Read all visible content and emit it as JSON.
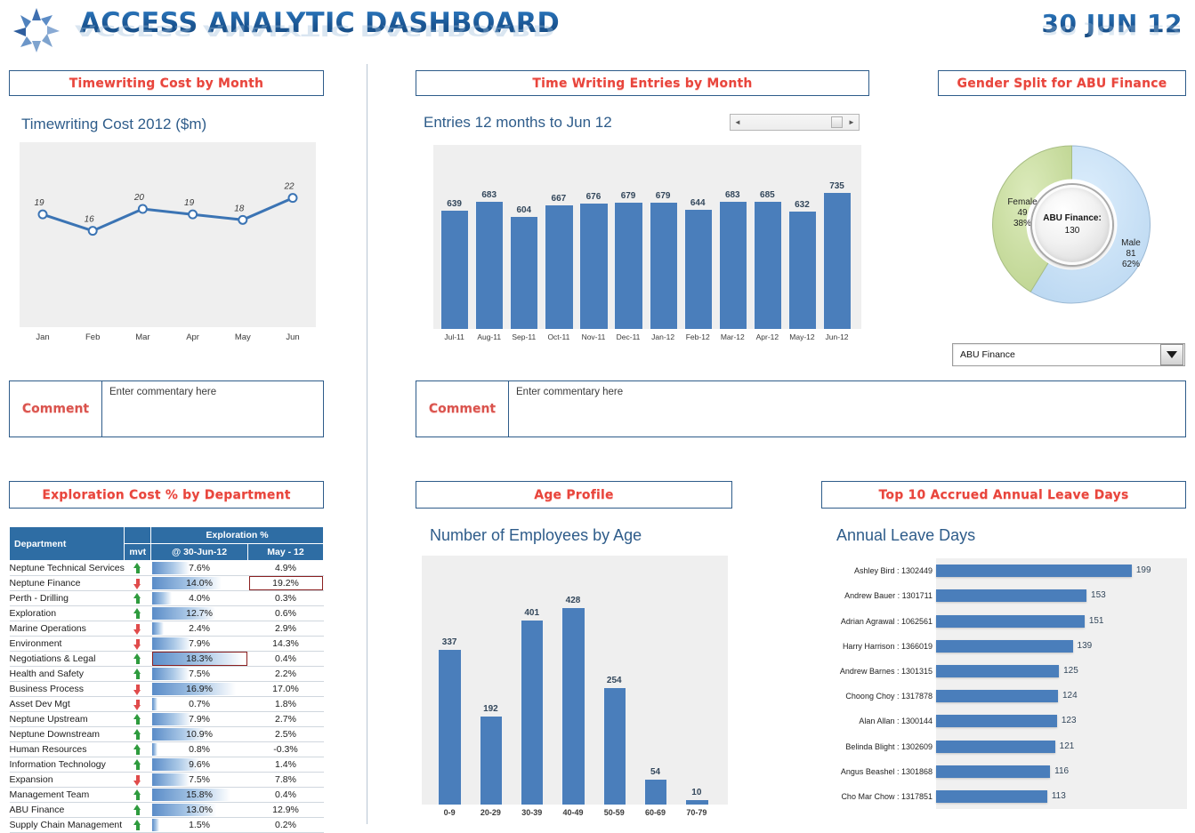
{
  "header": {
    "brand_title": "ACCESS ANALYTIC DASHBOARD",
    "report_date": "30 JUN 12",
    "logo_icon": "starburst-logo-icon"
  },
  "panels": {
    "timewriting_cost": "Timewriting Cost by Month",
    "time_writing_entries": "Time Writing Entries by Month",
    "gender_split": "Gender Split for ABU Finance",
    "exploration_cost": "Exploration Cost % by Department",
    "age_profile": "Age Profile",
    "top10_leave": "Top 10 Accrued Annual Leave Days"
  },
  "comments": {
    "label": "Comment",
    "placeholder": "Enter commentary here"
  },
  "gender": {
    "center_label": "ABU Finance:",
    "center_value": "130",
    "female": {
      "name": "Female",
      "count": "49",
      "pct": "38%",
      "color": "#C5DC9B"
    },
    "male": {
      "name": "Male",
      "count": "81",
      "pct": "62%",
      "color": "#C5DFF5"
    },
    "selector_value": "ABU Finance",
    "selector_options": [
      "ABU Finance"
    ]
  },
  "entries_scrollbar": {
    "left_arrow": "◄",
    "right_arrow": "►"
  },
  "exploration_table": {
    "columns": {
      "department": "Department",
      "group": "Exploration %",
      "mvt": "mvt",
      "current": "@ 30-Jun-12",
      "previous": "May - 12"
    },
    "rows": [
      {
        "department": "Neptune Technical Services",
        "mvt": "up",
        "current": "7.6%",
        "current_val": 7.6,
        "previous": "4.9%",
        "hl_current": false,
        "hl_previous": false
      },
      {
        "department": "Neptune Finance",
        "mvt": "down",
        "current": "14.0%",
        "current_val": 14.0,
        "previous": "19.2%",
        "hl_current": false,
        "hl_previous": true
      },
      {
        "department": "Perth - Drilling",
        "mvt": "up",
        "current": "4.0%",
        "current_val": 4.0,
        "previous": "0.3%",
        "hl_current": false,
        "hl_previous": false
      },
      {
        "department": "Exploration",
        "mvt": "up",
        "current": "12.7%",
        "current_val": 12.7,
        "previous": "0.6%",
        "hl_current": false,
        "hl_previous": false
      },
      {
        "department": "Marine Operations",
        "mvt": "down",
        "current": "2.4%",
        "current_val": 2.4,
        "previous": "2.9%",
        "hl_current": false,
        "hl_previous": false
      },
      {
        "department": "Environment",
        "mvt": "down",
        "current": "7.9%",
        "current_val": 7.9,
        "previous": "14.3%",
        "hl_current": false,
        "hl_previous": false
      },
      {
        "department": "Negotiations & Legal",
        "mvt": "up",
        "current": "18.3%",
        "current_val": 18.3,
        "previous": "0.4%",
        "hl_current": true,
        "hl_previous": false
      },
      {
        "department": "Health and Safety",
        "mvt": "up",
        "current": "7.5%",
        "current_val": 7.5,
        "previous": "2.2%",
        "hl_current": false,
        "hl_previous": false
      },
      {
        "department": "Business Process",
        "mvt": "down",
        "current": "16.9%",
        "current_val": 16.9,
        "previous": "17.0%",
        "hl_current": false,
        "hl_previous": false
      },
      {
        "department": "Asset Dev Mgt",
        "mvt": "down",
        "current": "0.7%",
        "current_val": 0.7,
        "previous": "1.8%",
        "hl_current": false,
        "hl_previous": false
      },
      {
        "department": "Neptune Upstream",
        "mvt": "up",
        "current": "7.9%",
        "current_val": 7.9,
        "previous": "2.7%",
        "hl_current": false,
        "hl_previous": false
      },
      {
        "department": "Neptune Downstream",
        "mvt": "up",
        "current": "10.9%",
        "current_val": 10.9,
        "previous": "2.5%",
        "hl_current": false,
        "hl_previous": false
      },
      {
        "department": "Human Resources",
        "mvt": "up",
        "current": "0.8%",
        "current_val": 0.8,
        "previous": "-0.3%",
        "hl_current": false,
        "hl_previous": false
      },
      {
        "department": "Information Technology",
        "mvt": "up",
        "current": "9.6%",
        "current_val": 9.6,
        "previous": "1.4%",
        "hl_current": false,
        "hl_previous": false
      },
      {
        "department": "Expansion",
        "mvt": "down",
        "current": "7.5%",
        "current_val": 7.5,
        "previous": "7.8%",
        "hl_current": false,
        "hl_previous": false
      },
      {
        "department": "Management Team",
        "mvt": "up",
        "current": "15.8%",
        "current_val": 15.8,
        "previous": "0.4%",
        "hl_current": false,
        "hl_previous": false
      },
      {
        "department": "ABU Finance",
        "mvt": "up",
        "current": "13.0%",
        "current_val": 13.0,
        "previous": "12.9%",
        "hl_current": false,
        "hl_previous": false
      },
      {
        "department": "Supply Chain Management",
        "mvt": "up",
        "current": "1.5%",
        "current_val": 1.5,
        "previous": "0.2%",
        "hl_current": false,
        "hl_previous": false
      }
    ]
  },
  "chart_data": [
    {
      "id": "timewriting_cost",
      "type": "line",
      "title": "Timewriting Cost 2012 ($m)",
      "categories": [
        "Jan",
        "Feb",
        "Mar",
        "Apr",
        "May",
        "Jun"
      ],
      "values": [
        19,
        16,
        20,
        19,
        18,
        22
      ],
      "xlabel": "",
      "ylabel": "",
      "ylim": [
        0,
        26
      ],
      "grid": false,
      "legend": "none",
      "series_color": "#3B74B4"
    },
    {
      "id": "time_writing_entries",
      "type": "bar",
      "title": "Entries 12 months to Jun 12",
      "categories": [
        "Jul-11",
        "Aug-11",
        "Sep-11",
        "Oct-11",
        "Nov-11",
        "Dec-11",
        "Jan-12",
        "Feb-12",
        "Mar-12",
        "Apr-12",
        "May-12",
        "Jun-12"
      ],
      "values": [
        639,
        683,
        604,
        667,
        676,
        679,
        679,
        644,
        683,
        685,
        632,
        735
      ],
      "xlabel": "",
      "ylabel": "",
      "ylim": [
        0,
        800
      ],
      "grid": false,
      "legend": "none",
      "series_color": "#4A7EBB"
    },
    {
      "id": "gender_split",
      "type": "pie",
      "title": "Gender Split for ABU Finance",
      "categories": [
        "Male",
        "Female"
      ],
      "values": [
        81,
        49
      ],
      "percentages": [
        "62%",
        "38%"
      ],
      "total": 130,
      "legend": "labels-on-slices"
    },
    {
      "id": "age_profile",
      "type": "bar",
      "title": "Number of Employees by Age",
      "categories": [
        "0-9",
        "20-29",
        "30-39",
        "40-49",
        "50-59",
        "60-69",
        "70-79"
      ],
      "values": [
        337,
        192,
        401,
        428,
        254,
        54,
        10
      ],
      "xlabel": "",
      "ylabel": "",
      "ylim": [
        0,
        460
      ],
      "grid": false,
      "legend": "none",
      "series_color": "#4A7EBB"
    },
    {
      "id": "top10_leave",
      "type": "bar",
      "orientation": "horizontal",
      "title": "Annual Leave Days",
      "categories": [
        "Ashley Bird : 1302449",
        "Andrew Bauer : 1301711",
        "Adrian Agrawal : 1062561",
        "Harry Harrison : 1366019",
        "Andrew Barnes : 1301315",
        "Choong Choy : 1317878",
        "Alan Allan : 1300144",
        "Belinda Blight : 1302609",
        "Angus Beashel : 1301868",
        "Cho Mar Chow : 1317851"
      ],
      "values": [
        199,
        153,
        151,
        139,
        125,
        124,
        123,
        121,
        116,
        113
      ],
      "xlabel": "",
      "ylabel": "",
      "xlim": [
        0,
        210
      ],
      "grid": false,
      "legend": "none",
      "series_color": "#4A7EBB"
    }
  ]
}
